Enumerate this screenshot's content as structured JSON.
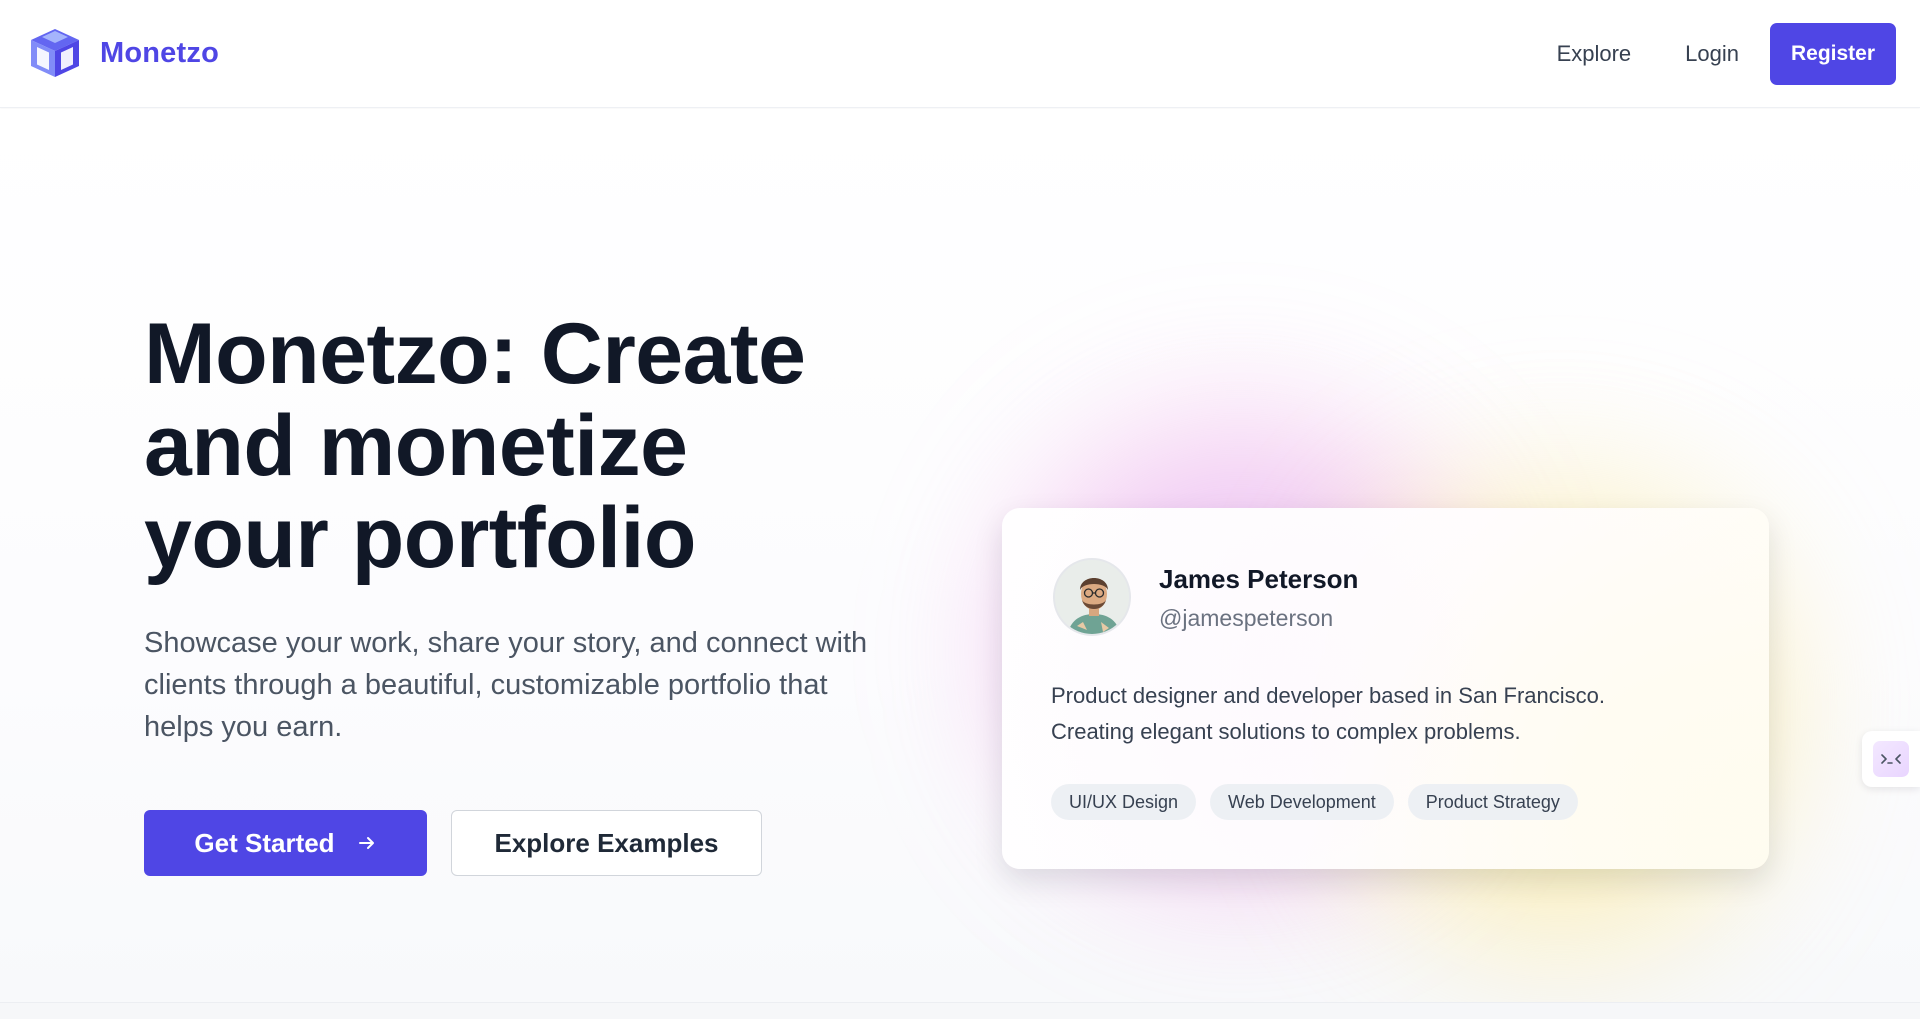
{
  "header": {
    "brand": "Monetzo",
    "nav": {
      "explore": "Explore",
      "login": "Login",
      "register": "Register"
    }
  },
  "hero": {
    "title_line1": "Monetzo: Create",
    "title_line2": "and monetize",
    "title_line3": "your portfolio",
    "subtitle": "Showcase your work, share your story, and connect with clients through a beautiful, customizable portfolio that helps you earn.",
    "primary_cta": "Get Started",
    "secondary_cta": "Explore Examples"
  },
  "profile_card": {
    "name": "James Peterson",
    "handle": "@jamespeterson",
    "bio_line1": "Product designer and developer based in San Francisco.",
    "bio_line2": "Creating elegant solutions to complex problems.",
    "tags": [
      "UI/UX Design",
      "Web Development",
      "Product Strategy"
    ]
  },
  "icons": {
    "logo": "cube-logo-icon",
    "cta_arrow": "arrow-right-icon",
    "dev_widget": "terminal-icon"
  },
  "colors": {
    "brand": "#4f46e5",
    "heading": "#111827",
    "body": "#4b5563",
    "glow_purple": "#c084fc",
    "glow_yellow": "#fde047"
  }
}
